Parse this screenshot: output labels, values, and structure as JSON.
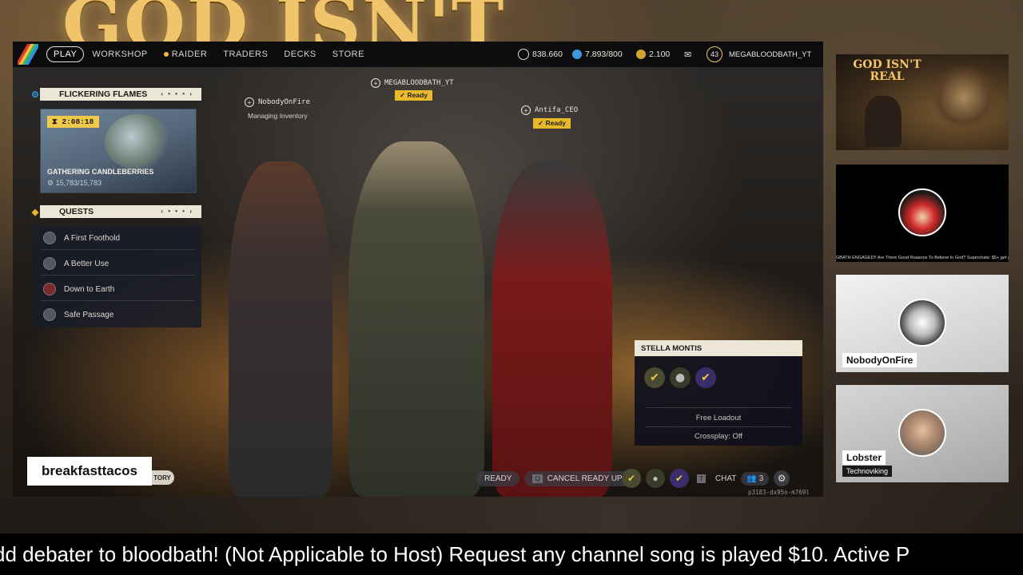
{
  "background": {
    "title": "GOD ISN'T"
  },
  "game": {
    "nav": [
      "PLAY",
      "WORKSHOP",
      "RAIDER",
      "TRADERS",
      "DECKS",
      "STORE"
    ],
    "currencies": {
      "coins": "838.660",
      "tokens": "7.893/800",
      "credits": "2.100"
    },
    "level": "43",
    "username": "MEGABLOODBATH_YT",
    "event": {
      "header": "FLICKERING FLAMES",
      "timer": "2:08:18",
      "title": "GATHERING CANDLEBERRIES",
      "progress": "15,783/15,783"
    },
    "quests": {
      "header": "QUESTS",
      "items": [
        "A First Foothold",
        "A Better Use",
        "Down to Earth",
        "Safe Passage"
      ]
    },
    "players": [
      {
        "name": "NobodyOnFire",
        "status": "Managing Inventory"
      },
      {
        "name": "MEGABLOODBATH_YT",
        "status": "Ready"
      },
      {
        "name": "Antifa_CEO",
        "status": "Ready"
      }
    ],
    "loadout": {
      "character": "STELLA MONTIS",
      "loadout": "Free Loadout",
      "crossplay": "Crossplay: Off"
    },
    "bottom": {
      "ready": "READY",
      "cancel_key": "Q",
      "cancel": "CANCEL READY UP",
      "chat_key": "T",
      "chat": "CHAT",
      "party_count": "3",
      "history_stub": "TORY",
      "version": "p3183-dx95n-m769l"
    }
  },
  "overlay": {
    "streamer_name": "breakfasttacos",
    "thumbnail_title": "GOD ISN'T REAL",
    "black_tile_ticker": "GBATH ENGAGED!! Are There Good Reasons To Believe In God? Superchats: $5+ get you a questio",
    "participants": [
      {
        "name": "NobodyOnFire"
      },
      {
        "name": "Lobster",
        "subtitle": "Technoviking"
      }
    ],
    "ticker": "dd debater to bloodbath! (Not Applicable to Host) Request any channel song is played $10. Active P"
  },
  "colors": {
    "accent_ready": "#e8b928",
    "panel_header": "#ece6d6",
    "bg_title": "#f0c46a"
  }
}
